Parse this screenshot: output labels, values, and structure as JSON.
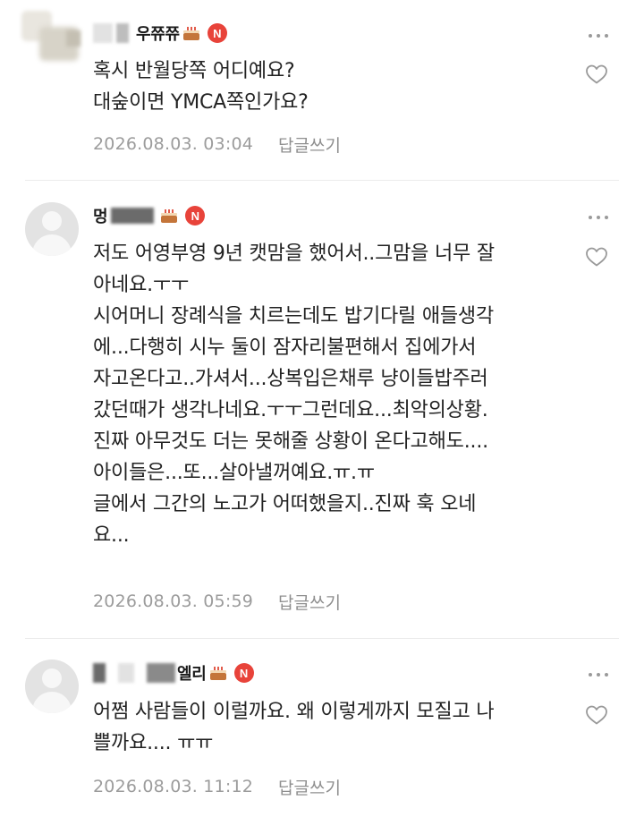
{
  "comments": [
    {
      "nickname": "우쮸쮸",
      "badge": "N",
      "lines": [
        "혹시 반월당쪽 어디예요?",
        "대숲이면 YMCA쪽인가요?"
      ],
      "date": "2026.08.03. 03:04",
      "reply_label": "답글쓰기"
    },
    {
      "nickname": "멍",
      "badge": "N",
      "lines": [
        "저도 어영부영 9년 캣맘을 했어서..그맘을 너무 잘",
        "아네요.ㅜㅜ",
        "시어머니 장례식을 치르는데도 밥기다릴 애들생각",
        "에...다행히 시누 둘이 잠자리불편해서 집에가서",
        "자고온다고..가셔서...상복입은채루 냥이들밥주러",
        "갔던때가 생각나네요.ㅜㅜ그런데요...최악의상황.",
        "진짜 아무것도 더는 못해줄 상황이 온다고해도....",
        "아이들은...또...살아낼꺼예요.ㅠ.ㅠ",
        "글에서 그간의 노고가 어떠했을지..진짜 훅 오네",
        "요..."
      ],
      "date": "2026.08.03. 05:59",
      "reply_label": "답글쓰기"
    },
    {
      "nickname": "엘리",
      "badge": "N",
      "lines": [
        "어쩜 사람들이 이럴까요. 왜 이렇게까지 모질고 나",
        "쁠까요.... ㅠㅠ"
      ],
      "date": "2026.08.03. 11:12",
      "reply_label": "답글쓰기"
    }
  ],
  "icons": {
    "more": "more-options-icon",
    "like": "heart-outline-icon",
    "avatar": "default-avatar-icon",
    "cake": "cake-icon"
  },
  "colors": {
    "badge": "#e8433a",
    "meta_text": "#9c9c9c",
    "body_text": "#222222"
  }
}
